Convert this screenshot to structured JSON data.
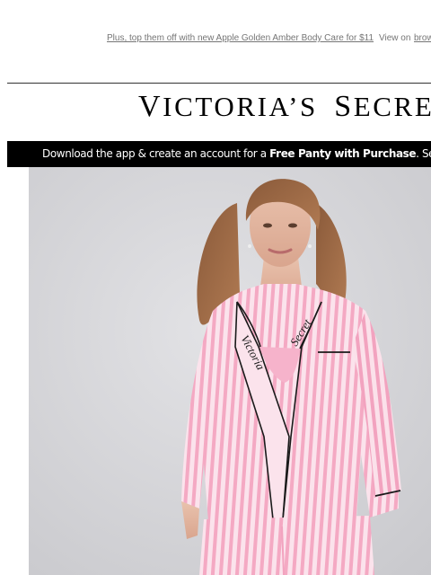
{
  "preheader": {
    "promo_text": "Plus, top them off with new Apple Golden Amber Body Care for $11",
    "view_on_text": "View on",
    "browser_link_text": "brow"
  },
  "header": {
    "brand_logo": "VICTORIA'S SECRET"
  },
  "banner": {
    "text_before": "Download the app & create an account for a ",
    "highlight": "Free Panty with Purchase",
    "text_after": ". See"
  },
  "hero": {
    "image_icon": "pajama-model-photo",
    "shirt_embroidery_left": "Victoria",
    "shirt_embroidery_right": "Secret",
    "colors": {
      "background": "#d6d6da",
      "stripe_pink": "#f4a9c3",
      "stripe_white": "#fbe3ec",
      "piping": "#1a1a1a"
    }
  }
}
